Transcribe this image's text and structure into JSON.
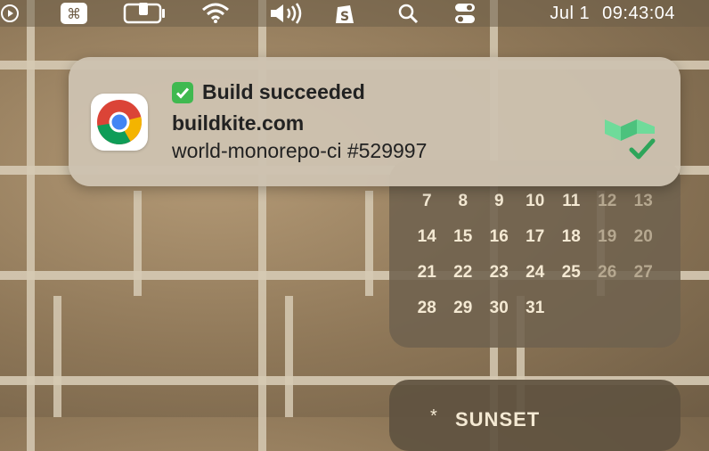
{
  "menubar": {
    "date": "Jul 1",
    "time": "09:43:04"
  },
  "notification": {
    "title_emoji": "✅",
    "title": "Build succeeded",
    "subtitle": "buildkite.com",
    "body": "world-monorepo-ci #529997",
    "app_icon": "chrome-icon",
    "attachment_icon": "buildkite-success-icon"
  },
  "calendar": {
    "rows": [
      [
        {
          "d": "7",
          "dim": false
        },
        {
          "d": "8",
          "dim": false
        },
        {
          "d": "9",
          "dim": false
        },
        {
          "d": "10",
          "dim": false
        },
        {
          "d": "11",
          "dim": false
        },
        {
          "d": "12",
          "dim": true
        },
        {
          "d": "13",
          "dim": true
        }
      ],
      [
        {
          "d": "14",
          "dim": false
        },
        {
          "d": "15",
          "dim": false
        },
        {
          "d": "16",
          "dim": false
        },
        {
          "d": "17",
          "dim": false
        },
        {
          "d": "18",
          "dim": false
        },
        {
          "d": "19",
          "dim": true
        },
        {
          "d": "20",
          "dim": true
        }
      ],
      [
        {
          "d": "21",
          "dim": false
        },
        {
          "d": "22",
          "dim": false
        },
        {
          "d": "23",
          "dim": false
        },
        {
          "d": "24",
          "dim": false
        },
        {
          "d": "25",
          "dim": false
        },
        {
          "d": "26",
          "dim": true
        },
        {
          "d": "27",
          "dim": true
        }
      ],
      [
        {
          "d": "28",
          "dim": false
        },
        {
          "d": "29",
          "dim": false
        },
        {
          "d": "30",
          "dim": false
        },
        {
          "d": "31",
          "dim": false
        }
      ]
    ]
  },
  "sunset_widget": {
    "label": "SUNSET"
  },
  "colors": {
    "success_green": "#3fb950",
    "buildkite_green": "#5fd08a"
  }
}
